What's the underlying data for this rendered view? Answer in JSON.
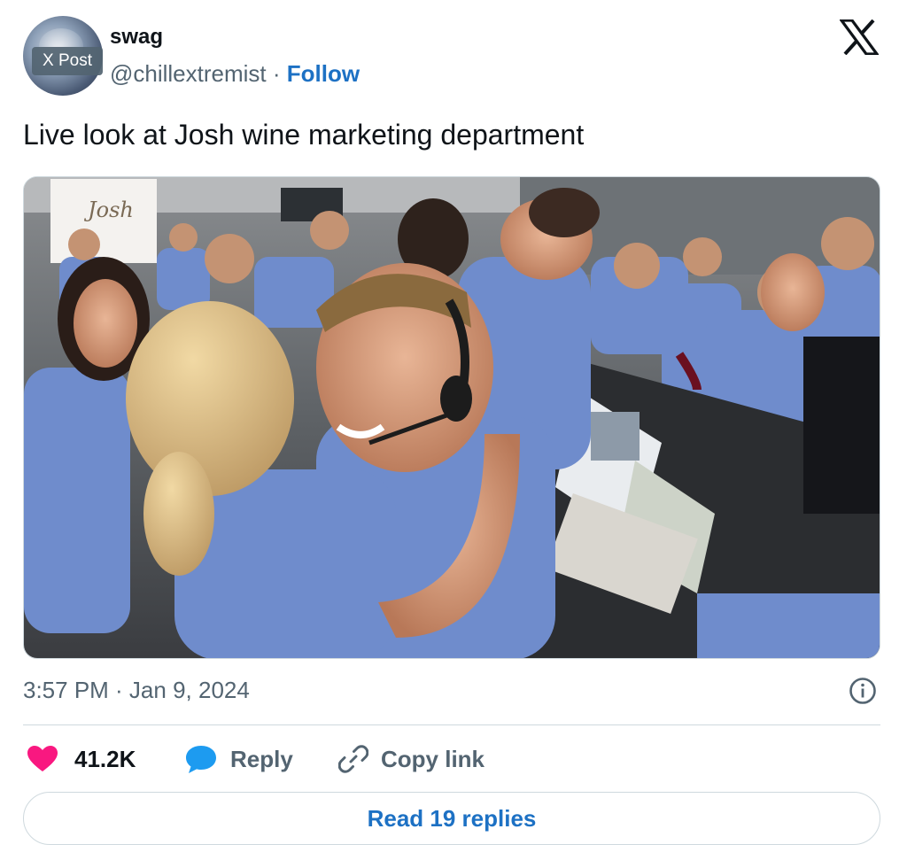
{
  "author": {
    "display_name": "swag",
    "handle": "@chillextremist",
    "separator": " · ",
    "follow_label": "Follow",
    "avatar_badge": "X Post"
  },
  "tweet": {
    "text": "Live look at Josh wine marketing department",
    "timestamp": "3:57 PM · Jan 9, 2024",
    "media_sign_text": "Josh"
  },
  "actions": {
    "like_count": "41.2K",
    "reply_label": "Reply",
    "copy_link_label": "Copy link",
    "read_replies_label": "Read 19 replies"
  },
  "icons": {
    "brand": "x-logo-icon",
    "info": "info-icon",
    "like": "heart-icon",
    "reply": "speech-bubble-icon",
    "copy": "link-icon"
  },
  "colors": {
    "link_blue": "#1d71c4",
    "heart_pink": "#f91880",
    "reply_blue": "#1d9bf0",
    "muted_text": "#536471",
    "border": "#cfd9de"
  }
}
